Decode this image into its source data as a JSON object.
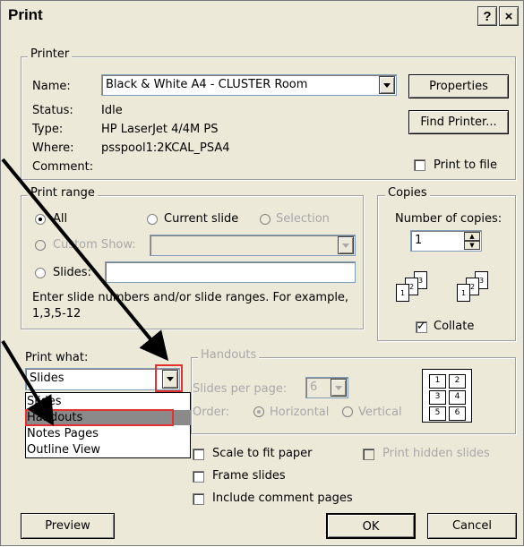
{
  "window": {
    "title": "Print",
    "help_button": "?",
    "close_button": "×"
  },
  "printer": {
    "legend": "Printer",
    "name_label": "Name:",
    "name_value": "Black & White A4 - CLUSTER Room",
    "status_label": "Status:",
    "status_value": "Idle",
    "type_label": "Type:",
    "type_value": "HP LaserJet 4/4M PS",
    "where_label": "Where:",
    "where_value": "psspool1:2KCAL_PSA4",
    "comment_label": "Comment:",
    "properties_button": "Properties",
    "find_printer_button": "Find Printer...",
    "print_to_file_label": "Print to file"
  },
  "print_range": {
    "legend": "Print range",
    "all_label": "All",
    "current_slide_label": "Current slide",
    "selection_label": "Selection",
    "custom_show_label": "Custom Show:",
    "slides_label": "Slides:",
    "hint": "Enter slide numbers and/or slide ranges. For example,",
    "hint_example": "1,3,5-12"
  },
  "copies": {
    "legend": "Copies",
    "number_label": "Number of copies:",
    "number_value": "1",
    "collate_label": "Collate",
    "collate_pages": [
      "1",
      "2",
      "3"
    ]
  },
  "print_what": {
    "label": "Print what:",
    "value": "Slides",
    "options": [
      "Slides",
      "Handouts",
      "Notes Pages",
      "Outline View"
    ],
    "highlighted": "Handouts"
  },
  "handouts": {
    "legend": "Handouts",
    "slides_per_page_label": "Slides per page:",
    "slides_per_page_value": "6",
    "order_label": "Order:",
    "horizontal_label": "Horizontal",
    "vertical_label": "Vertical",
    "preview_numbers": [
      "1",
      "2",
      "3",
      "4",
      "5",
      "6"
    ]
  },
  "options": {
    "scale_label": "Scale to fit paper",
    "frame_label": "Frame slides",
    "comment_pages_label": "Include comment pages",
    "hidden_slides_label": "Print hidden slides"
  },
  "footer": {
    "preview_button": "Preview",
    "ok_button": "OK",
    "cancel_button": "Cancel"
  },
  "colors": {
    "dialog_bg": "#ece9d8",
    "highlight_box": "#e53030",
    "annotation_arrow": "#000000"
  }
}
